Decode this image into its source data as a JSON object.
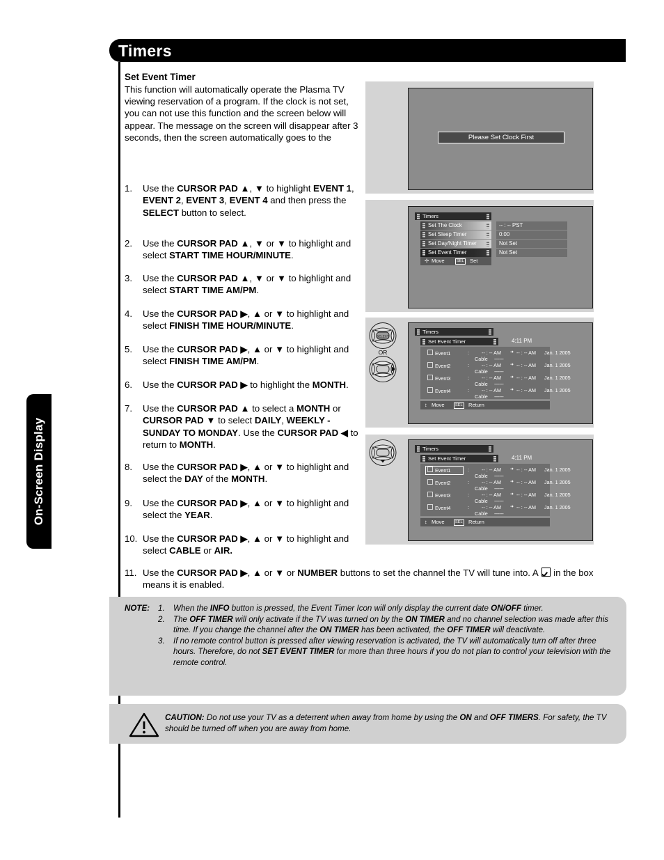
{
  "header": {
    "title": "Timers"
  },
  "side_tab": {
    "label": "On-Screen Display"
  },
  "section": {
    "heading": "Set Event Timer",
    "intro": "This function will automatically operate the Plasma TV viewing reservation of a program. If the clock is not set, you can not use this function and the screen below will appear. The message on the screen will disappear after 3 seconds, then the screen automatically goes to the"
  },
  "steps": [
    {
      "n": "1.",
      "html": "Use the <b>CURSOR PAD ▲</b>, <b>▼</b> to highlight <b>EVENT 1</b>, <b>EVENT 2</b>, <b>EVENT 3</b>, <b>EVENT 4</b> and then press the <b>SELECT</b> button to select."
    },
    {
      "n": "2.",
      "html": "Use the <b>CURSOR PAD ▲</b>, <b>▼</b> or <b>▼</b> to highlight and select <b>START TIME HOUR/MINUTE</b>."
    },
    {
      "n": "3.",
      "html": "Use the <b>CURSOR PAD ▲</b>, <b>▼</b> or <b>▼</b> to highlight and select <b>START TIME AM/PM</b>."
    },
    {
      "n": "4.",
      "html": "Use the <b>CURSOR PAD ▶</b>, <b>▲</b> or <b>▼</b> to highlight and select <b>FINISH TIME HOUR/MINUTE</b>."
    },
    {
      "n": "5.",
      "html": "Use the <b>CURSOR PAD ▶</b>, <b>▲</b> or <b>▼</b> to highlight and select <b>FINISH TIME AM/PM</b>."
    },
    {
      "n": "6.",
      "html": "Use the <b>CURSOR PAD ▶</b> to highlight the <b>MONTH</b>."
    },
    {
      "n": "7.",
      "html": "Use the <b>CURSOR PAD ▲</b> to select a <b>MONTH</b> or <b>CURSOR PAD ▼</b> to select <b>DAILY</b>, <b>WEEKLY - SUNDAY TO MONDAY</b>. Use the <b>CURSOR PAD ◀</b> to return to <b>MONTH</b>."
    },
    {
      "n": "8.",
      "html": "Use the <b>CURSOR PAD ▶</b>, <b>▲</b> or <b>▼</b> to highlight and select the <b>DAY</b> of the <b>MONTH</b>."
    },
    {
      "n": "9.",
      "html": "Use the <b>CURSOR PAD ▶</b>, <b>▲</b> or <b>▼</b> to highlight and select the <b>YEAR</b>."
    },
    {
      "n": "10.",
      "html": "Use the <b>CURSOR PAD ▶</b>, <b>▲</b> or <b>▼</b> to highlight and select <b>CABLE</b> or <b>AIR.</b>"
    }
  ],
  "step11": {
    "n": "11.",
    "html_before": "Use the <b>CURSOR PAD ▶</b>, <b>▲</b> or <b>▼</b> or <b>NUMBER</b> buttons to set the channel the TV will tune into. A ",
    "html_after": " in the box means it is enabled."
  },
  "screens": {
    "screen1": {
      "message": "Please Set Clock First"
    },
    "screen2": {
      "title": "Timers",
      "items": [
        {
          "label": "Set The Clock",
          "value": "-- : --  PST",
          "selected": false
        },
        {
          "label": "Set Sleep Timer",
          "value": "0:00",
          "selected": false
        },
        {
          "label": "Set Day/Night Timer",
          "value": "Not Set",
          "selected": false
        },
        {
          "label": "Set Event Timer",
          "value": "Not Set",
          "selected": true
        }
      ],
      "nav_move": "Move",
      "nav_key": "SEL",
      "nav_action": "Set"
    },
    "screen3": {
      "title": "Timers",
      "subtitle": "Set Event Timer",
      "clock": "4:11 PM",
      "events": [
        {
          "name": "Event1",
          "sep": ":",
          "start": "-- : -- AM",
          "arrow": "➜",
          "finish": "-- : -- AM",
          "date": "Jan. 1 2005",
          "source": "Cable",
          "channel": "-------"
        },
        {
          "name": "Event2",
          "sep": ":",
          "start": "-- : -- AM",
          "arrow": "➜",
          "finish": "-- : -- AM",
          "date": "Jan. 1 2005",
          "source": "Cable",
          "channel": "-------"
        },
        {
          "name": "Event3",
          "sep": ":",
          "start": "-- : -- AM",
          "arrow": "➜",
          "finish": "-- : -- AM",
          "date": "Jan. 1 2005",
          "source": "Cable",
          "channel": "-------"
        },
        {
          "name": "Event4",
          "sep": ":",
          "start": "-- : -- AM",
          "arrow": "➜",
          "finish": "-- : -- AM",
          "date": "Jan. 1 2005",
          "source": "Cable",
          "channel": "-------"
        }
      ],
      "nav_move": "Move",
      "nav_key": "SEL",
      "nav_action": "Return",
      "or_label": "OR",
      "highlight_event": -1
    },
    "screen4": {
      "title": "Timers",
      "subtitle": "Set Event Timer",
      "clock": "4:11 PM",
      "events": [
        {
          "name": "Event1",
          "sep": ":",
          "start": "-- : -- AM",
          "arrow": "➜",
          "finish": "-- : -- AM",
          "date": "Jan. 1 2005",
          "source": "Cable",
          "channel": "-------"
        },
        {
          "name": "Event2",
          "sep": ":",
          "start": "-- : -- AM",
          "arrow": "➜",
          "finish": "-- : -- AM",
          "date": "Jan. 1 2005",
          "source": "Cable",
          "channel": "-------"
        },
        {
          "name": "Event3",
          "sep": ":",
          "start": "-- : -- AM",
          "arrow": "➜",
          "finish": "-- : -- AM",
          "date": "Jan. 1 2005",
          "source": "Cable",
          "channel": "-------"
        },
        {
          "name": "Event4",
          "sep": ":",
          "start": "-- : -- AM",
          "arrow": "➜",
          "finish": "-- : -- AM",
          "date": "Jan. 1 2005",
          "source": "Cable",
          "channel": "-------"
        }
      ],
      "nav_move": "Move",
      "nav_key": "SEL",
      "nav_action": "Return",
      "highlight_event": 0
    }
  },
  "note": {
    "label": "NOTE:",
    "items": [
      {
        "n": "1.",
        "html": "When the <b>INFO</b> button is pressed, the Event Timer Icon will only display the current date <b>ON/OFF</b> timer."
      },
      {
        "n": "2.",
        "html": "The <b>OFF TIMER</b> will only activate if the TV was turned on by the <b>ON TIMER</b> and no channel selection was made after this time. If you change the channel after the <b>ON TIMER</b> has been activated, the <b>OFF TIMER</b> will deactivate."
      },
      {
        "n": "3.",
        "html": "If no remote control button is pressed after viewing reservation is activated, the TV will automatically turn off after three hours. Therefore, do not <b>SET EVENT TIMER</b> for more than three hours if you do not plan to control your television with the remote control."
      }
    ]
  },
  "caution": {
    "label": "CAUTION:",
    "html": "Do not use your TV as a deterrent when away from home by using the <b>ON</b> and <b>OFF TIMERS</b>. For safety, the TV should be turned off when you are away from home."
  },
  "colors": {
    "banner_bg": "#000000",
    "panel_bg": "#d4d4d4",
    "tv_bg": "#8c8c8c",
    "note_bg": "#d0d0d0",
    "osd_dark": "#2b2b2b",
    "osd_value": "#6e6e6e"
  }
}
